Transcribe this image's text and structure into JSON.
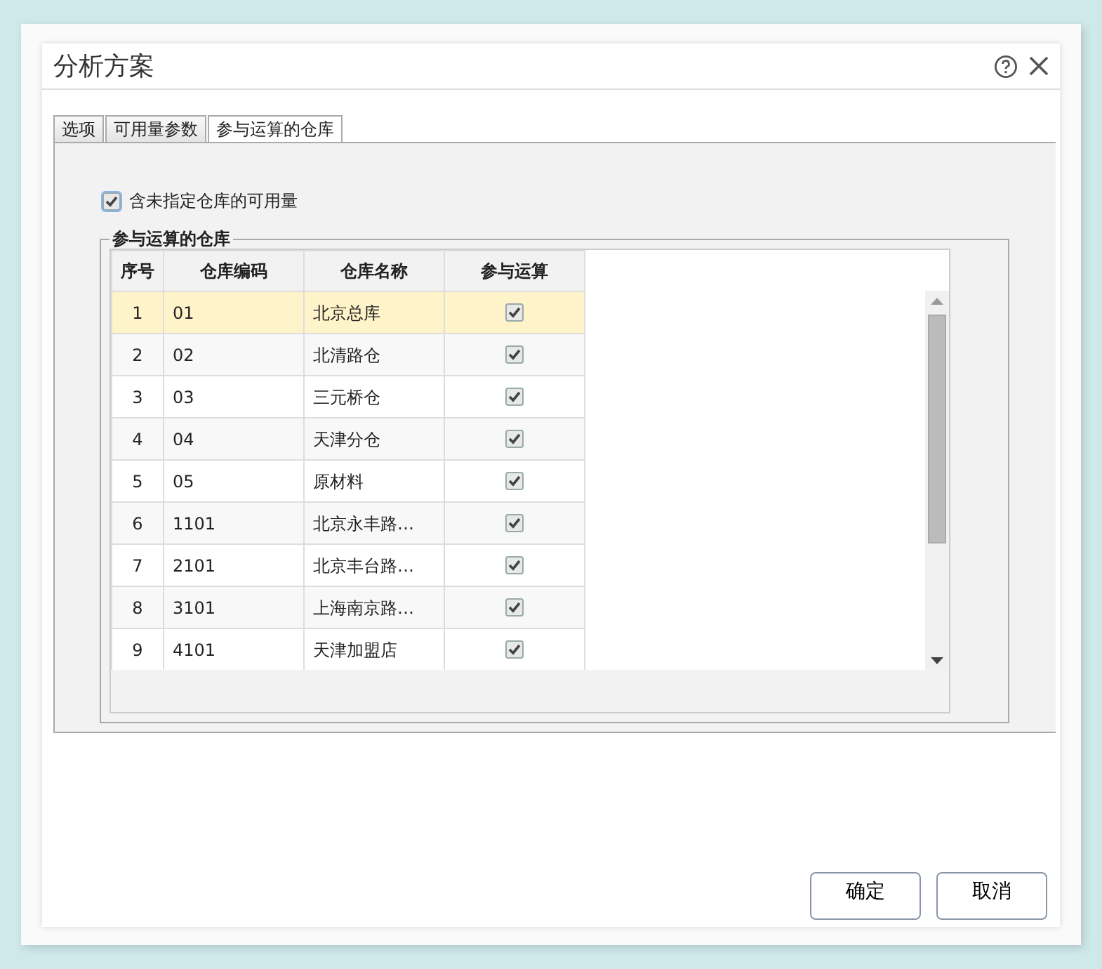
{
  "window": {
    "title": "分析方案"
  },
  "tabs": [
    {
      "label": "选项",
      "selected": false
    },
    {
      "label": "可用量参数",
      "selected": false
    },
    {
      "label": "参与运算的仓库",
      "selected": true
    }
  ],
  "option": {
    "label": "含未指定仓库的可用量",
    "checked": true
  },
  "group": {
    "legend": "参与运算的仓库",
    "columns": [
      "序号",
      "仓库编码",
      "仓库名称",
      "参与运算"
    ],
    "rows": [
      {
        "no": "1",
        "code": "01",
        "name": "北京总库",
        "included": true,
        "selected": true
      },
      {
        "no": "2",
        "code": "02",
        "name": "北清路仓",
        "included": true,
        "selected": false
      },
      {
        "no": "3",
        "code": "03",
        "name": "三元桥仓",
        "included": true,
        "selected": false
      },
      {
        "no": "4",
        "code": "04",
        "name": "天津分仓",
        "included": true,
        "selected": false
      },
      {
        "no": "5",
        "code": "05",
        "name": "原材料",
        "included": true,
        "selected": false
      },
      {
        "no": "6",
        "code": "1101",
        "name": "北京永丰路…",
        "included": true,
        "selected": false
      },
      {
        "no": "7",
        "code": "2101",
        "name": "北京丰台路…",
        "included": true,
        "selected": false
      },
      {
        "no": "8",
        "code": "3101",
        "name": "上海南京路…",
        "included": true,
        "selected": false
      },
      {
        "no": "9",
        "code": "4101",
        "name": "天津加盟店",
        "included": true,
        "selected": false
      }
    ]
  },
  "buttons": [
    "确定",
    "取消"
  ]
}
